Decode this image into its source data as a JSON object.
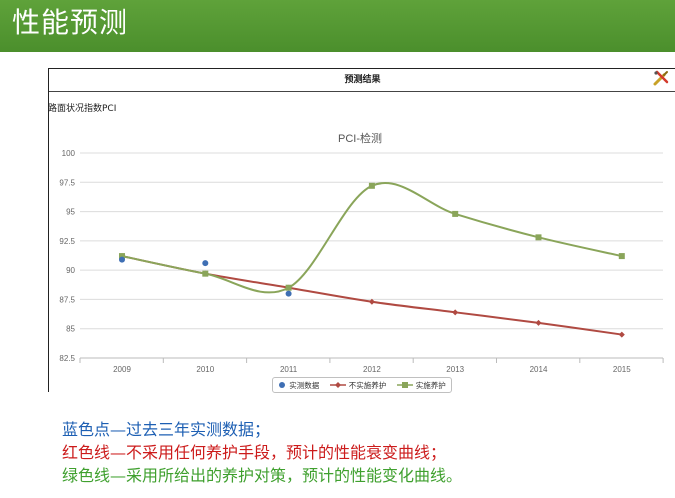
{
  "header": {
    "title": "性能预测"
  },
  "panel": {
    "title": "预测结果",
    "index_label": "路面状况指数PCI",
    "tool_icon": "edit-tools-icon"
  },
  "colors": {
    "header_green": "#4b8f2c",
    "measured": "#3f6fb4",
    "no_maintenance": "#b04a42",
    "maintenance": "#8aa55a"
  },
  "chart_data": {
    "type": "line",
    "title": "PCI-检测",
    "categories": [
      "2009",
      "2010",
      "2011",
      "2012",
      "2013",
      "2014",
      "2015"
    ],
    "ylim": [
      82.5,
      100
    ],
    "yticks": [
      "100",
      "97.5",
      "95",
      "92.5",
      "90",
      "87.5",
      "85",
      "82.5"
    ],
    "grid": true,
    "legend": "bottom",
    "series": [
      {
        "name": "实测数据",
        "kind": "scatter",
        "color": "#3f6fb4",
        "values": [
          90.9,
          90.6,
          88.0
        ]
      },
      {
        "name": "不实施养护",
        "kind": "line",
        "color": "#b04a42",
        "values": [
          91.2,
          89.7,
          88.5,
          87.3,
          86.4,
          85.5,
          84.5
        ]
      },
      {
        "name": "实施养护",
        "kind": "line",
        "color": "#8aa55a",
        "values": [
          91.2,
          89.7,
          88.5,
          97.2,
          94.8,
          92.8,
          91.2
        ]
      }
    ]
  },
  "notes": {
    "line1": "蓝色点—过去三年实测数据；",
    "line2": "红色线—不采用任何养护手段，预计的性能衰变曲线；",
    "line3": "绿色线—采用所给出的养护对策，预计的性能变化曲线。"
  }
}
